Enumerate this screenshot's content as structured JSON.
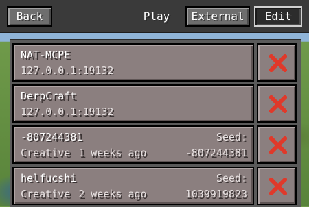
{
  "header": {
    "back_label": "Back",
    "tabs": [
      {
        "label": "Play",
        "selected": false
      },
      {
        "label": "External",
        "selected": false
      },
      {
        "label": "Edit",
        "selected": true
      }
    ]
  },
  "servers": [
    {
      "name": "NAT-MCPE",
      "address": "127.0.0.1:19132"
    },
    {
      "name": "DerpCraft",
      "address": "127.0.0.1:19132"
    }
  ],
  "worlds": [
    {
      "name": "-807244381",
      "seed_label": "Seed:",
      "mode": "Creative",
      "age": "1 weeks ago",
      "seed": "-807244381"
    },
    {
      "name": "helfucshi",
      "seed_label": "Seed:",
      "mode": "Creative",
      "age": "2 weeks ago",
      "seed": "1039919823"
    }
  ],
  "icons": {
    "delete": "red-x-icon"
  },
  "colors": {
    "accent_delete": "#e0392a",
    "row_bg": "#8b7f7f",
    "topbar": "#3a3a3a"
  }
}
